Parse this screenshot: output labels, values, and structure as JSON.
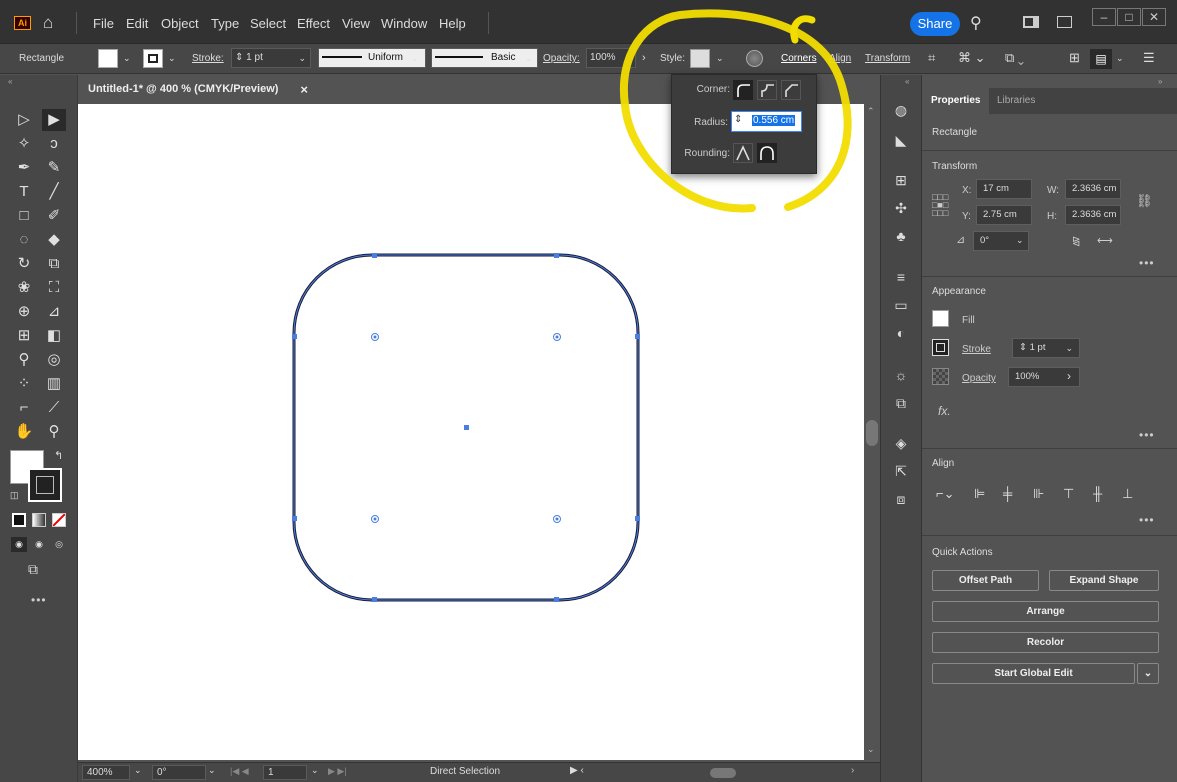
{
  "app": {
    "logo": "Ai",
    "menus": [
      "File",
      "Edit",
      "Object",
      "Type",
      "Select",
      "Effect",
      "View",
      "Window",
      "Help"
    ],
    "share_label": "Share",
    "accent": "#1473e6"
  },
  "controlbar": {
    "object_type": "Rectangle",
    "stroke_label": "Stroke:",
    "stroke_value": "1 pt",
    "profile_label": "Uniform",
    "brush_label": "Basic",
    "opacity_label": "Opacity:",
    "opacity_value": "100%",
    "style_label": "Style:",
    "corners_label": "Corners",
    "align_label": "Align",
    "transform_label": "Transform"
  },
  "document": {
    "tab_title": "Untitled-1* @ 400 % (CMYK/Preview)",
    "close_icon": "×"
  },
  "corners_popup": {
    "corner_label": "Corner:",
    "radius_label": "Radius:",
    "radius_value": "0.556 cm",
    "rounding_label": "Rounding:"
  },
  "properties": {
    "tabs": [
      "Properties",
      "Libraries"
    ],
    "object_type": "Rectangle",
    "transform_title": "Transform",
    "x_label": "X:",
    "x_value": "17 cm",
    "y_label": "Y:",
    "y_value": "2.75 cm",
    "w_label": "W:",
    "w_value": "2.3636 cm",
    "h_label": "H:",
    "h_value": "2.3636 cm",
    "angle_value": "0°",
    "appearance_title": "Appearance",
    "fill_label": "Fill",
    "stroke_label": "Stroke",
    "stroke_value": "1 pt",
    "opacity_label": "Opacity",
    "opacity_value": "100%",
    "fx_label": "fx.",
    "align_title": "Align",
    "quick_actions_title": "Quick Actions",
    "offset_path": "Offset Path",
    "expand_shape": "Expand Shape",
    "arrange": "Arrange",
    "recolor": "Recolor",
    "global_edit": "Start Global Edit"
  },
  "status": {
    "zoom": "400%",
    "rotation": "0°",
    "artboard": "1",
    "tool": "Direct Selection"
  },
  "colors": {
    "annotation": "#f2dd00",
    "selection": "#4a7fe0",
    "shape_stroke": "#1a1a33"
  }
}
